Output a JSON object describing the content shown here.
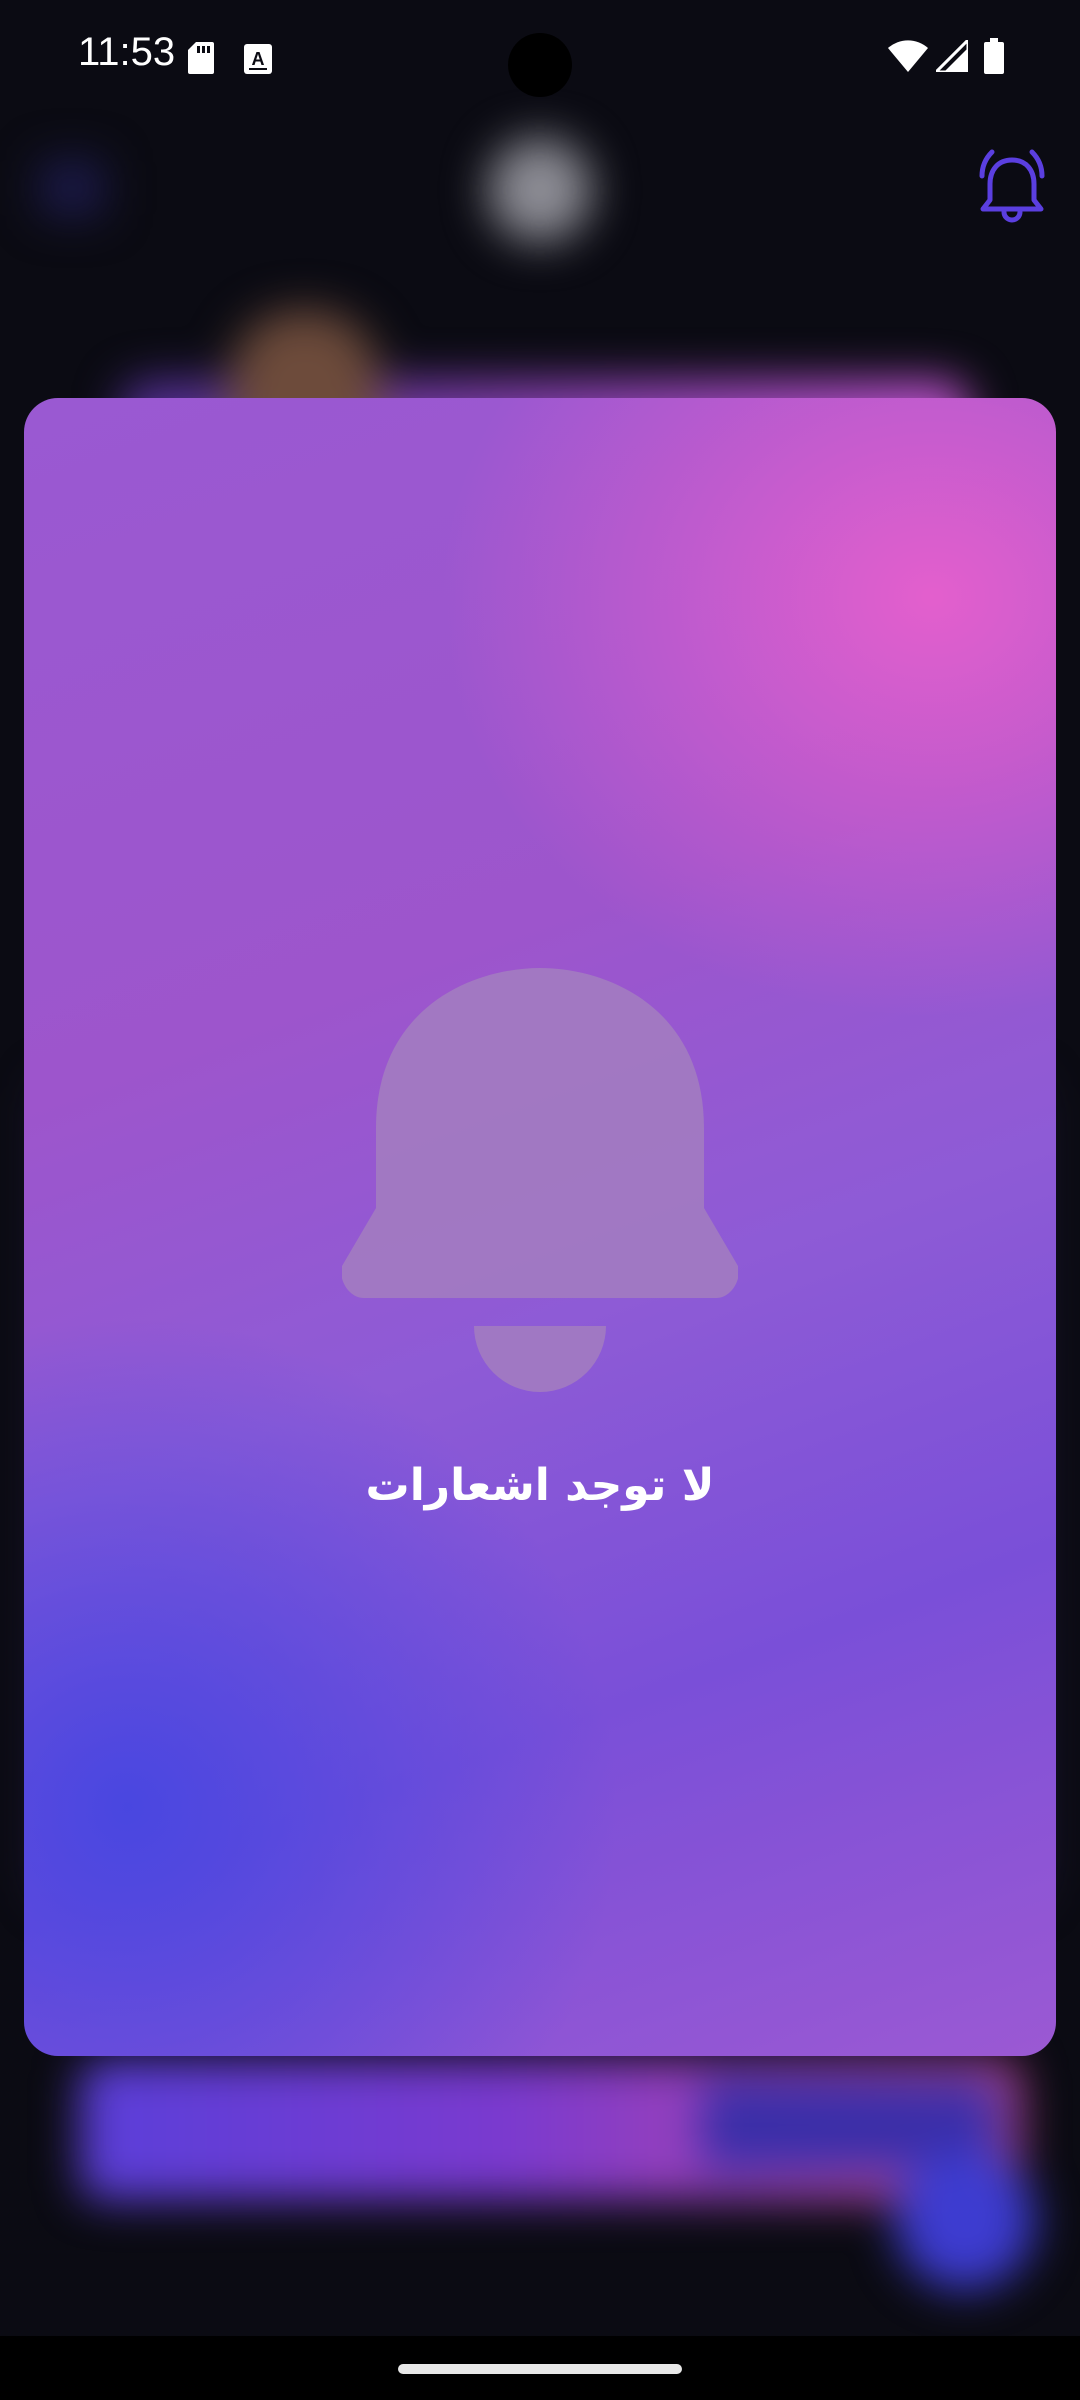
{
  "status_bar": {
    "time": "11:53",
    "icons": [
      "sd-card-icon",
      "keyboard-a-icon",
      "wifi-icon",
      "signal-icon",
      "battery-icon"
    ]
  },
  "header": {
    "notification_icon": "bell-ringing-icon",
    "accent_color": "#5b3fe0"
  },
  "notifications_panel": {
    "empty_icon": "bell-icon",
    "empty_message": "لا توجد اشعارات",
    "gradient_colors": [
      "#e960cd",
      "#9d55cc",
      "#4646e1"
    ]
  }
}
